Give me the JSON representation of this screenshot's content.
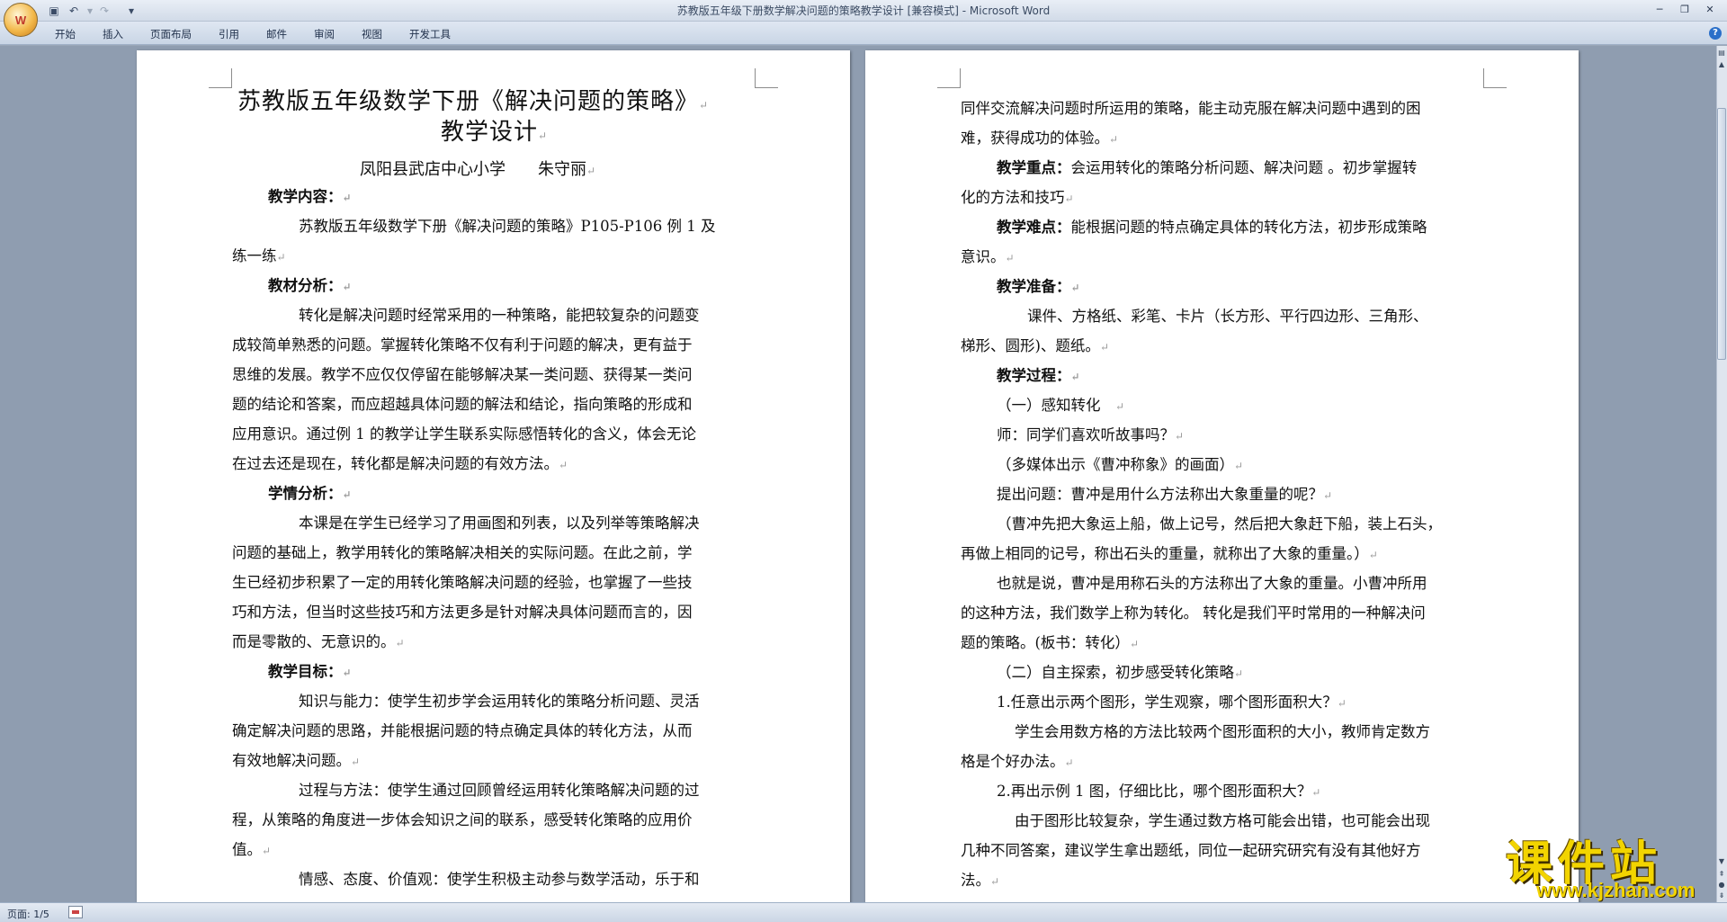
{
  "app": {
    "window_title": "苏教版五年级下册数学解决问题的策略教学设计 [兼容模式] - Microsoft Word",
    "office_button_glyph": "W",
    "quick_access": {
      "save_icon": "save-icon",
      "undo_icon": "undo-icon",
      "redo_icon": "redo-icon",
      "customize_icon": "customize-qat-icon"
    }
  },
  "ribbon": {
    "tabs": [
      "开始",
      "插入",
      "页面布局",
      "引用",
      "邮件",
      "审阅",
      "视图",
      "开发工具"
    ],
    "help_glyph": "?"
  },
  "status": {
    "page_indicator": "页面: 1/5"
  },
  "watermark": {
    "main": "课件站",
    "url": "www.kjzhan.com"
  },
  "pilcrow": "↵",
  "page1": {
    "title_line1": "苏教版五年级数学下册《解决问题的策略》",
    "title_line2": "教学设计",
    "author": "凤阳县武店中心小学　　朱守丽",
    "h_content": "教学内容：",
    "content_l1": "苏教版五年级数学下册《解决问题的策略》P105-P106 例 1 及",
    "content_l2": "练一练",
    "h_material": "教材分析：",
    "material": [
      "转化是解决问题时经常采用的一种策略，能把较复杂的问题变",
      "成较简单熟悉的问题。掌握转化策略不仅有利于问题的解决，更有益于",
      "思维的发展。教学不应仅仅停留在能够解决某一类问题、获得某一类问",
      "题的结论和答案，而应超越具体问题的解法和结论，指向策略的形成和",
      "应用意识。通过例 1 的教学让学生联系实际感悟转化的含义，体会无论",
      "在过去还是现在，转化都是解决问题的有效方法。"
    ],
    "h_students": "学情分析：",
    "students": [
      "本课是在学生已经学习了用画图和列表，以及列举等策略解决",
      "问题的基础上，教学用转化的策略解决相关的实际问题。在此之前，学",
      "生已经初步积累了一定的用转化策略解决问题的经验，也掌握了一些技",
      "巧和方法，但当时这些技巧和方法更多是针对解决具体问题而言的，因",
      "而是零散的、无意识的。"
    ],
    "h_goals": "教学目标：",
    "goals": [
      "知识与能力：使学生初步学会运用转化的策略分析问题、灵活",
      "确定解决问题的思路，并能根据问题的特点确定具体的转化方法，从而",
      "有效地解决问题。",
      "过程与方法：使学生通过回顾曾经运用转化策略解决问题的过",
      "程，从策略的角度进一步体会知识之间的联系，感受转化策略的应用价",
      "值。",
      "情感、态度、价值观：使学生积极主动参与数学活动，乐于和"
    ]
  },
  "page2": {
    "intro": [
      "同伴交流解决问题时所运用的策略，能主动克服在解决问题中遇到的困",
      "难，获得成功的体验。"
    ],
    "key_label": "教学重点：",
    "key_text": "会运用转化的策略分析问题、解决问题 。初步掌握转",
    "key_l2": "化的方法和技巧",
    "diff_label": "教学难点：",
    "diff_text": "能根据问题的特点确定具体的转化方法，初步形成策略",
    "diff_l2": "意识。",
    "h_prep": "教学准备：",
    "prep": [
      "课件、方格纸、彩笔、卡片（长方形、平行四边形、三角形、",
      "梯形、圆形)、题纸。"
    ],
    "h_process": "教学过程：",
    "process": [
      "（一）感知转化",
      "师：同学们喜欢听故事吗？",
      "（多媒体出示《曹冲称象》的画面）",
      "提出问题：曹冲是用什么方法称出大象重量的呢？",
      "（曹冲先把大象运上船，做上记号，然后把大象赶下船，装上石头，",
      "再做上相同的记号，称出石头的重量，就称出了大象的重量。）",
      "也就是说，曹冲是用称石头的方法称出了大象的重量。小曹冲所用",
      "的这种方法，我们数学上称为转化。 转化是我们平时常用的一种解决问",
      "题的策略。(板书：转化）",
      "（二）自主探索，初步感受转化策略",
      "1.任意出示两个图形，学生观察，哪个图形面积大？",
      "学生会用数方格的方法比较两个图形面积的大小，教师肯定数方",
      "格是个好办法。",
      "2.再出示例 1 图，仔细比比，哪个图形面积大？",
      "由于图形比较复杂，学生通过数方格可能会出错，也可能会出现",
      "几种不同答案，建议学生拿出题纸，同位一起研究研究有没有其他好方",
      "法。"
    ]
  }
}
